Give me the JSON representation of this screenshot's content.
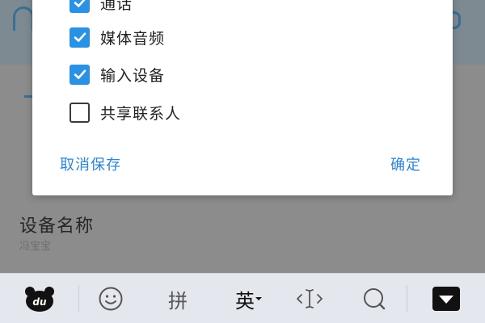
{
  "background": {
    "device_name_label": "设备名称",
    "device_name_value": "冯宝宝"
  },
  "dialog": {
    "options": [
      {
        "label": "通话",
        "checked": true
      },
      {
        "label": "媒体音频",
        "checked": true
      },
      {
        "label": "输入设备",
        "checked": true
      },
      {
        "label": "共享联系人",
        "checked": false
      }
    ],
    "cancel_label": "取消保存",
    "confirm_label": "确定"
  },
  "keyboard": {
    "pinyin_label": "拼",
    "english_label": "英",
    "icons": [
      "keyboard-logo-icon",
      "emoji-icon",
      "cursor-icon",
      "search-icon",
      "hide-keyboard-icon"
    ]
  },
  "colors": {
    "accent": "#2a92e5",
    "link": "#2a86d9",
    "overlay": "#8c8c8c"
  }
}
